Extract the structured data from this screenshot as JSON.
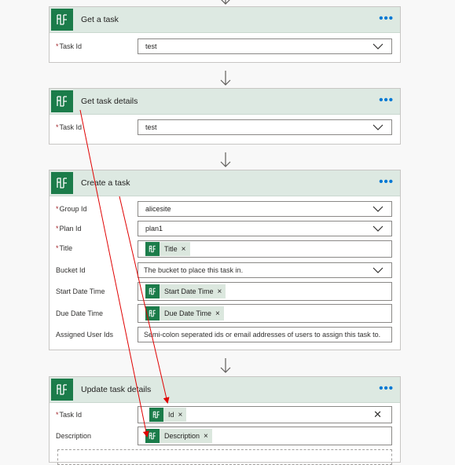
{
  "cards": [
    {
      "title": "Get a task",
      "more": "•••",
      "fields": [
        {
          "label": "Task Id",
          "value": "test"
        }
      ]
    },
    {
      "title": "Get task details",
      "more": "•••",
      "fields": [
        {
          "label": "Task Id",
          "value": "test"
        }
      ]
    },
    {
      "title": "Create a task",
      "more": "•••",
      "fields": [
        {
          "label": "Group Id",
          "value": "alicesite"
        },
        {
          "label": "Plan Id",
          "value": "plan1"
        },
        {
          "label": "Title",
          "token": "Title"
        },
        {
          "label": "Bucket Id",
          "placeholder": "The bucket to place this task in."
        },
        {
          "label": "Start Date Time",
          "token": "Start Date Time"
        },
        {
          "label": "Due Date Time",
          "token": "Due Date Time"
        },
        {
          "label": "Assigned User Ids",
          "placeholder": "Semi-colon seperated ids or email addresses of users to assign this task to."
        }
      ]
    },
    {
      "title": "Update task details",
      "more": "•••",
      "fields": [
        {
          "label": "Task Id",
          "token": "Id"
        },
        {
          "label": "Description",
          "token": "Description"
        }
      ]
    }
  ],
  "required_marker": "*",
  "token_remove": "×",
  "clear_symbol": "✕",
  "colors": {
    "header_bg": "#dde9e2",
    "app_green": "#1b7c4a",
    "token_bg": "#dbe7de",
    "accent_blue": "#0078d4",
    "required_red": "#a4262c",
    "annotation_red": "#e00000"
  },
  "icons": {
    "app": "planner-icon",
    "dropdown": "chevron-down-icon",
    "connector": "arrow-down-icon"
  }
}
